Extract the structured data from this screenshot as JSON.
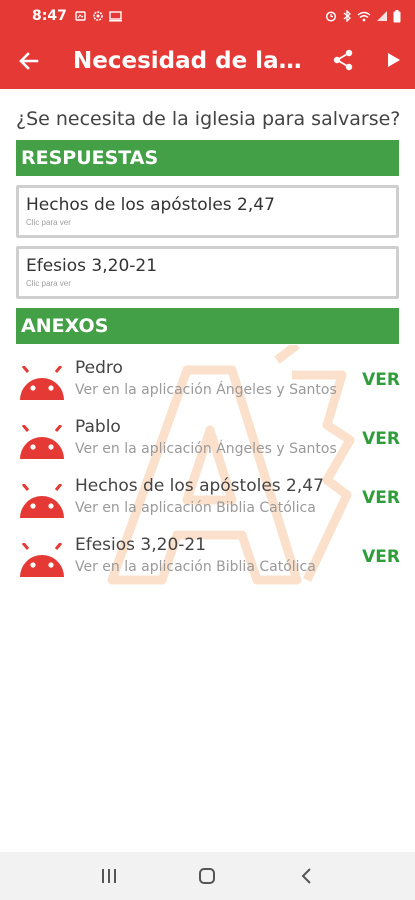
{
  "status_bar": {
    "time": "8:47"
  },
  "app_bar": {
    "title": "Necesidad de la i..."
  },
  "question": "¿Se necesita de la iglesia para salvarse?",
  "respuestas": {
    "header": "RESPUESTAS",
    "items": [
      {
        "title": "Hechos de los apóstoles 2,47",
        "hint": "Clic para ver"
      },
      {
        "title": "Efesios 3,20-21",
        "hint": "Clic para ver"
      }
    ]
  },
  "anexos": {
    "header": "ANEXOS",
    "items": [
      {
        "title": "Pedro",
        "subtitle": "Ver en la aplicación Ángeles y Santos",
        "action": "VER"
      },
      {
        "title": "Pablo",
        "subtitle": "Ver en la aplicación Ángeles y Santos",
        "action": "VER"
      },
      {
        "title": "Hechos de los apóstoles 2,47",
        "subtitle": "Ver en la aplicación Biblia Católica",
        "action": "VER"
      },
      {
        "title": "Efesios 3,20-21",
        "subtitle": "Ver en la aplicación Biblia Católica",
        "action": "VER"
      }
    ]
  },
  "colors": {
    "primary": "#e53935",
    "section": "#43a047",
    "action": "#2e9d3a",
    "watermark": "#fbe0cc"
  },
  "icons": [
    "back-arrow-icon",
    "share-icon",
    "play-icon",
    "android-icon",
    "recents-icon",
    "home-icon",
    "back-icon"
  ]
}
